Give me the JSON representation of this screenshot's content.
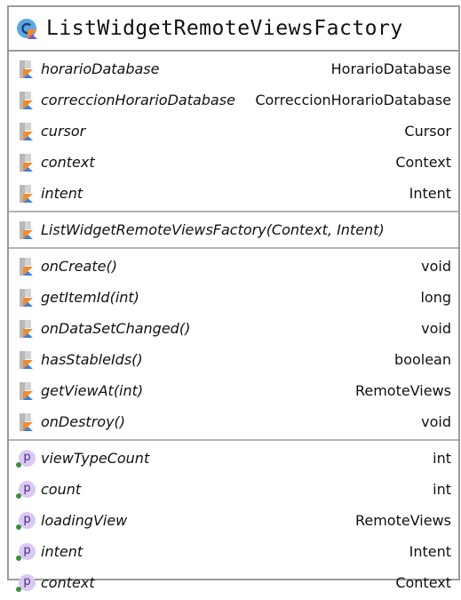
{
  "class_name": "ListWidgetRemoteViewsFactory",
  "fields": [
    {
      "name": "horarioDatabase",
      "type": "HorarioDatabase"
    },
    {
      "name": "correccionHorarioDatabase",
      "type": "CorreccionHorarioDatabase"
    },
    {
      "name": "cursor",
      "type": "Cursor"
    },
    {
      "name": "context",
      "type": "Context"
    },
    {
      "name": "intent",
      "type": "Intent"
    }
  ],
  "constructors": [
    {
      "name": "ListWidgetRemoteViewsFactory(Context, Intent)"
    }
  ],
  "methods": [
    {
      "name": "onCreate()",
      "type": "void"
    },
    {
      "name": "getItemId(int)",
      "type": "long"
    },
    {
      "name": "onDataSetChanged()",
      "type": "void"
    },
    {
      "name": "hasStableIds()",
      "type": "boolean"
    },
    {
      "name": "getViewAt(int)",
      "type": "RemoteViews"
    },
    {
      "name": "onDestroy()",
      "type": "void"
    }
  ],
  "properties": [
    {
      "name": "viewTypeCount",
      "type": "int"
    },
    {
      "name": "count",
      "type": "int"
    },
    {
      "name": "loadingView",
      "type": "RemoteViews"
    },
    {
      "name": "intent",
      "type": "Intent"
    },
    {
      "name": "context",
      "type": "Context"
    }
  ],
  "icons": {
    "class": "kotlin-class-icon",
    "field": "kotlin-field-icon",
    "method": "kotlin-method-icon",
    "property": "property-icon",
    "property_letter": "p"
  },
  "colors": {
    "border": "#9b9b9b",
    "property_badge": "#d9c9f3",
    "property_letter": "#4b2b8a",
    "public_dot": "#3a8f3a"
  }
}
